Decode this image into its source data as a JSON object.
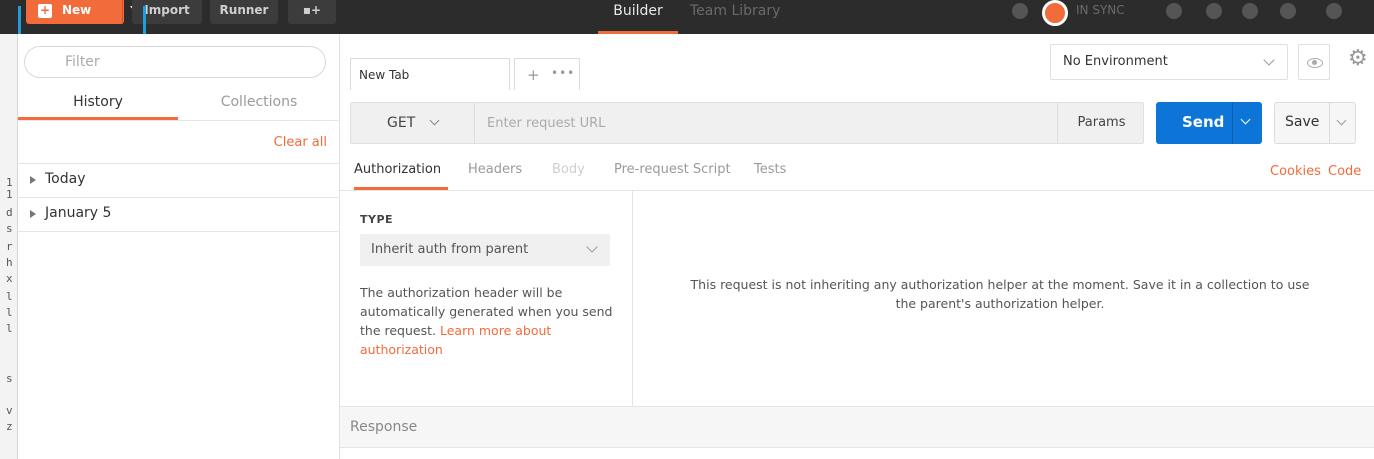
{
  "edge_strip": {
    "chars": [
      "1",
      "1",
      "d",
      "s",
      "r",
      "h",
      "x",
      "l",
      "l",
      "l",
      "s",
      "v",
      "z"
    ]
  },
  "header": {
    "new_label": "New",
    "import_label": "Import",
    "runner_label": "Runner",
    "new_window_icon": "new-window-icon",
    "tabs": [
      {
        "label": "Builder",
        "active": true
      },
      {
        "label": "Team Library",
        "active": false
      }
    ],
    "sync_status": "IN SYNC",
    "icons": [
      "satellite-icon",
      "sync-orb-icon",
      "wrench-icon",
      "chat-icon",
      "bell-icon",
      "heart-icon",
      "user-icon"
    ],
    "accent_color": "#f26b3a",
    "highlight_color": "#1e9ede"
  },
  "sidebar": {
    "filter_placeholder": "Filter",
    "tabs": [
      {
        "label": "History",
        "active": true
      },
      {
        "label": "Collections",
        "active": false
      }
    ],
    "clear_all_label": "Clear all",
    "groups": [
      {
        "label": "Today"
      },
      {
        "label": "January 5"
      }
    ]
  },
  "main": {
    "request_tab": {
      "label": "New Tab"
    },
    "tab_actions": {
      "add": "+",
      "more": "•••"
    },
    "environment": {
      "value": "No Environment"
    },
    "url_bar": {
      "method": "GET",
      "url_placeholder": "Enter request URL",
      "params_label": "Params"
    },
    "send_label": "Send",
    "save_label": "Save",
    "send_color": "#0d75d8",
    "subtabs": [
      {
        "label": "Authorization",
        "state": "active"
      },
      {
        "label": "Headers",
        "state": "normal"
      },
      {
        "label": "Body",
        "state": "disabled"
      },
      {
        "label": "Pre-request Script",
        "state": "normal"
      },
      {
        "label": "Tests",
        "state": "normal"
      }
    ],
    "links": {
      "cookies": "Cookies",
      "code": "Code"
    },
    "auth": {
      "type_label": "TYPE",
      "type_value": "Inherit auth from parent",
      "description": "The authorization header will be automatically generated when you send the request.",
      "learn_more": "Learn more about authorization",
      "message": "This request is not inheriting any authorization helper at the moment. Save it in a collection to use the parent's authorization helper."
    },
    "response_label": "Response"
  }
}
